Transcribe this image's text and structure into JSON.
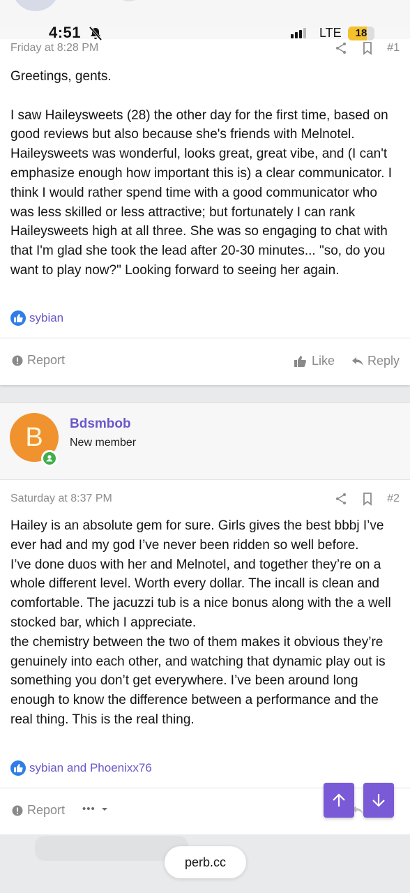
{
  "status_bar": {
    "time": "4:51",
    "network": "LTE",
    "battery_level": "18",
    "battery_fraction": 0.7,
    "battery_color": "#f4c12d"
  },
  "post1": {
    "date": "Friday at 8:28 PM",
    "number": "#1",
    "body": "Greetings, gents.\n\nI saw Haileysweets (28) the other day for the first time, based on good reviews but also because she's friends with Melnotel. Haileysweets was wonderful, looks great, great vibe, and (I can't emphasize enough how important this is) a clear communicator. I think I would rather spend time with a good communicator who was less skilled or less attractive; but fortunately I can rank Haileysweets high at all three. She was so engaging to chat with that I'm glad she took the lead after 20-30 minutes... \"so, do you want to play now?\" Looking forward to seeing her again.",
    "likes": "sybian",
    "report_label": "Report",
    "like_label": "Like",
    "reply_label": "Reply"
  },
  "post2": {
    "author": {
      "initial": "B",
      "name": "Bdsmbob",
      "role": "New member",
      "avatar_color": "#f0922e",
      "online_color": "#3fae4a"
    },
    "date": "Saturday at 8:37 PM",
    "number": "#2",
    "body": "Hailey is an absolute gem for sure. Girls gives the best bbbj I’ve ever had and my god I’ve never been ridden so well before.\nI’ve done duos with her and Melnotel, and together they’re on a whole different level. Worth every dollar. The incall is clean and comfortable. The jacuzzi tub is a nice bonus along with the a well stocked bar, which I appreciate.\nthe chemistry between the two of them makes it obvious they’re genuinely into each other, and watching that dynamic play out is something you don’t get everywhere. I’ve been around long enough to know the difference between a performance and the real thing. This is the real thing.",
    "likes": "sybian and Phoenixx76",
    "report_label": "Report",
    "more_label": "•••"
  },
  "browser": {
    "url": "perb.cc"
  },
  "colors": {
    "accent": "#6b57c9",
    "fab": "#7a5ad6",
    "like_icon": "#2f7ee8"
  }
}
